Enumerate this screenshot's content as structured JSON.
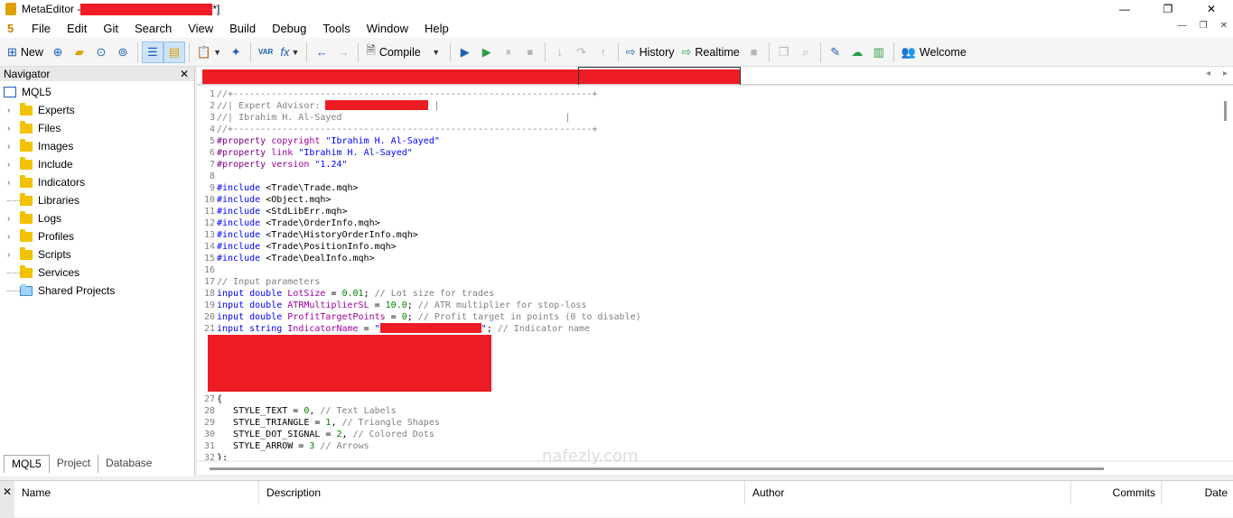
{
  "window": {
    "title_prefix": "MetaEditor - ",
    "title_suffix": "*]",
    "minimize": "—",
    "maximize": "❐",
    "close": "✕"
  },
  "menu": {
    "logo": "5",
    "items": [
      "File",
      "Edit",
      "Git",
      "Search",
      "View",
      "Build",
      "Debug",
      "Tools",
      "Window",
      "Help"
    ],
    "right_controls": [
      "—",
      "❐",
      "✕"
    ]
  },
  "toolbar": {
    "new_label": "New",
    "compile_label": "Compile",
    "history_label": "History",
    "realtime_label": "Realtime",
    "welcome_label": "Welcome",
    "var_label": "VAR",
    "fx_label": "fx"
  },
  "navigator": {
    "title": "Navigator",
    "close": "✕",
    "root": "MQL5",
    "items": [
      {
        "label": "Experts",
        "expandable": true
      },
      {
        "label": "Files",
        "expandable": true
      },
      {
        "label": "Images",
        "expandable": true
      },
      {
        "label": "Include",
        "expandable": true
      },
      {
        "label": "Indicators",
        "expandable": true
      },
      {
        "label": "Libraries",
        "expandable": false
      },
      {
        "label": "Logs",
        "expandable": true
      },
      {
        "label": "Profiles",
        "expandable": true
      },
      {
        "label": "Scripts",
        "expandable": true
      },
      {
        "label": "Services",
        "expandable": false
      },
      {
        "label": "Shared Projects",
        "expandable": false
      }
    ],
    "tabs": [
      "MQL5",
      "Project",
      "Database"
    ]
  },
  "editor": {
    "lines": [
      {
        "n": "1",
        "parts": [
          [
            "comment",
            "//+------------------------------------------------------------------+"
          ]
        ]
      },
      {
        "n": "2",
        "parts": [
          [
            "comment",
            "//| Expert Advisor: "
          ],
          [
            "redact",
            ""
          ],
          [
            "comment",
            " |"
          ]
        ]
      },
      {
        "n": "3",
        "parts": [
          [
            "comment",
            "//| Ibrahim H. Al-Sayed                                         |"
          ]
        ]
      },
      {
        "n": "4",
        "parts": [
          [
            "comment",
            "//+------------------------------------------------------------------+"
          ]
        ]
      },
      {
        "n": "5",
        "parts": [
          [
            "prop",
            "#property "
          ],
          [
            "purp",
            "copyright "
          ],
          [
            "str",
            "\"Ibrahim H. Al-Sayed\""
          ]
        ]
      },
      {
        "n": "6",
        "parts": [
          [
            "prop",
            "#property "
          ],
          [
            "purp",
            "link "
          ],
          [
            "str",
            "\"Ibrahim H. Al-Sayed\""
          ]
        ]
      },
      {
        "n": "7",
        "parts": [
          [
            "prop",
            "#property "
          ],
          [
            "purp",
            "version "
          ],
          [
            "str",
            "\"1.24\""
          ]
        ]
      },
      {
        "n": "8",
        "parts": []
      },
      {
        "n": "9",
        "parts": [
          [
            "kw",
            "#include "
          ],
          [
            "txt",
            "<Trade\\Trade.mqh>"
          ]
        ]
      },
      {
        "n": "10",
        "parts": [
          [
            "kw",
            "#include "
          ],
          [
            "txt",
            "<Object.mqh>"
          ]
        ]
      },
      {
        "n": "11",
        "parts": [
          [
            "kw",
            "#include "
          ],
          [
            "txt",
            "<StdLibErr.mqh>"
          ]
        ]
      },
      {
        "n": "12",
        "parts": [
          [
            "kw",
            "#include "
          ],
          [
            "txt",
            "<Trade\\OrderInfo.mqh>"
          ]
        ]
      },
      {
        "n": "13",
        "parts": [
          [
            "kw",
            "#include "
          ],
          [
            "txt",
            "<Trade\\HistoryOrderInfo.mqh>"
          ]
        ]
      },
      {
        "n": "14",
        "parts": [
          [
            "kw",
            "#include "
          ],
          [
            "txt",
            "<Trade\\PositionInfo.mqh>"
          ]
        ]
      },
      {
        "n": "15",
        "parts": [
          [
            "kw",
            "#include "
          ],
          [
            "txt",
            "<Trade\\DealInfo.mqh>"
          ]
        ]
      },
      {
        "n": "16",
        "parts": []
      },
      {
        "n": "17",
        "parts": [
          [
            "comment",
            "// Input parameters"
          ]
        ]
      },
      {
        "n": "18",
        "parts": [
          [
            "kw",
            "input double "
          ],
          [
            "purp",
            "LotSize"
          ],
          [
            "txt",
            " = "
          ],
          [
            "num",
            "0.01"
          ],
          [
            "txt",
            "; "
          ],
          [
            "comment",
            "// Lot size for trades"
          ]
        ]
      },
      {
        "n": "19",
        "parts": [
          [
            "kw",
            "input double "
          ],
          [
            "purp",
            "ATRMultiplierSL"
          ],
          [
            "txt",
            " = "
          ],
          [
            "num",
            "10.0"
          ],
          [
            "txt",
            "; "
          ],
          [
            "comment",
            "// ATR multiplier for stop-loss"
          ]
        ]
      },
      {
        "n": "20",
        "parts": [
          [
            "kw",
            "input double "
          ],
          [
            "purp",
            "ProfitTargetPoints"
          ],
          [
            "txt",
            " = "
          ],
          [
            "num",
            "0"
          ],
          [
            "txt",
            "; "
          ],
          [
            "comment",
            "// Profit target in points (0 to disable)"
          ]
        ]
      },
      {
        "n": "21",
        "parts": [
          [
            "kw",
            "input string "
          ],
          [
            "purp",
            "IndicatorName"
          ],
          [
            "txt",
            " = "
          ],
          [
            "str",
            "\""
          ],
          [
            "redact",
            ""
          ],
          [
            "str",
            "\""
          ],
          [
            "txt",
            "; "
          ],
          [
            "comment",
            "// Indicator name"
          ]
        ]
      },
      {
        "n": "",
        "parts": [
          [
            "block",
            ""
          ]
        ]
      },
      {
        "n": "",
        "parts": []
      },
      {
        "n": "",
        "parts": []
      },
      {
        "n": "",
        "parts": []
      },
      {
        "n": "",
        "parts": []
      },
      {
        "n": "27",
        "parts": [
          [
            "txt",
            "{"
          ]
        ]
      },
      {
        "n": "28",
        "parts": [
          [
            "txt",
            "   STYLE_TEXT = "
          ],
          [
            "num",
            "0"
          ],
          [
            "txt",
            ", "
          ],
          [
            "comment",
            "// Text Labels"
          ]
        ]
      },
      {
        "n": "29",
        "parts": [
          [
            "txt",
            "   STYLE_TRIANGLE = "
          ],
          [
            "num",
            "1"
          ],
          [
            "txt",
            ", "
          ],
          [
            "comment",
            "// Triangle Shapes"
          ]
        ]
      },
      {
        "n": "30",
        "parts": [
          [
            "txt",
            "   STYLE_DOT_SIGNAL = "
          ],
          [
            "num",
            "2"
          ],
          [
            "txt",
            ", "
          ],
          [
            "comment",
            "// Colored Dots"
          ]
        ]
      },
      {
        "n": "31",
        "parts": [
          [
            "txt",
            "   STYLE_ARROW = "
          ],
          [
            "num",
            "3"
          ],
          [
            "txt",
            " "
          ],
          [
            "comment",
            "// Arrows"
          ]
        ]
      },
      {
        "n": "32",
        "parts": [
          [
            "txt",
            "};"
          ]
        ]
      }
    ]
  },
  "bottom": {
    "close": "✕",
    "columns": [
      "Name",
      "Description",
      "Author",
      "Commits",
      "Date"
    ]
  },
  "watermark": "nafezly.com"
}
